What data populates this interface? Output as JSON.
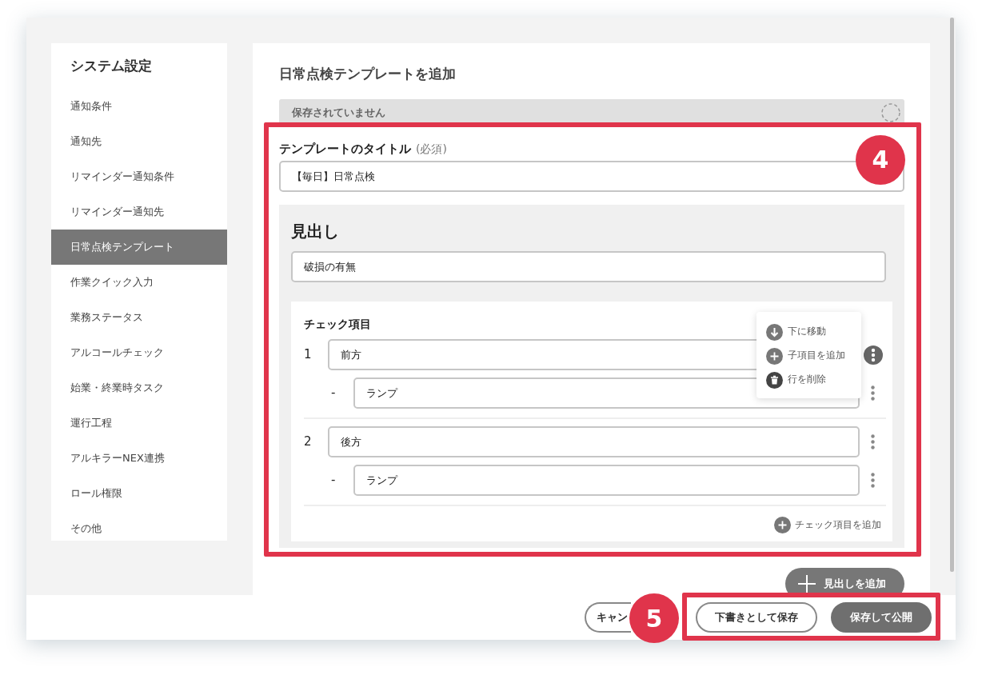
{
  "sidebar": {
    "title": "システム設定",
    "items": [
      {
        "label": "通知条件",
        "selected": false
      },
      {
        "label": "通知先",
        "selected": false
      },
      {
        "label": "リマインダー通知条件",
        "selected": false
      },
      {
        "label": "リマインダー通知先",
        "selected": false
      },
      {
        "label": "日常点検テンプレート",
        "selected": true
      },
      {
        "label": "作業クイック入力",
        "selected": false
      },
      {
        "label": "業務ステータス",
        "selected": false
      },
      {
        "label": "アルコールチェック",
        "selected": false
      },
      {
        "label": "始業・終業時タスク",
        "selected": false
      },
      {
        "label": "運行工程",
        "selected": false
      },
      {
        "label": "アルキラーNEX連携",
        "selected": false
      },
      {
        "label": "ロール権限",
        "selected": false
      },
      {
        "label": "その他",
        "selected": false
      }
    ]
  },
  "editor": {
    "title": "日常点検テンプレートを追加",
    "save_status": "保存されていません",
    "template_title": {
      "label": "テンプレートのタイトル",
      "required_mark": "(必須)",
      "value": "【毎日】日常点検"
    },
    "section": {
      "heading": "見出し",
      "value": "破損の有無",
      "checklist": {
        "title": "チェック項目",
        "items": [
          {
            "number": "1",
            "value": "前方",
            "menu_open": true,
            "children": [
              {
                "bullet": "-",
                "value": "ランプ",
                "menu_open": false
              }
            ]
          },
          {
            "number": "2",
            "value": "後方",
            "menu_open": false,
            "children": [
              {
                "bullet": "-",
                "value": "ランプ",
                "menu_open": false
              }
            ]
          }
        ],
        "menu": {
          "items": [
            {
              "kind": "move_down",
              "label": "下に移動"
            },
            {
              "kind": "add_child",
              "label": "子項目を追加"
            },
            {
              "kind": "delete",
              "label": "行を削除"
            }
          ]
        },
        "add_label": "チェック項目を追加"
      }
    },
    "add_heading_label": "見出しを追加"
  },
  "footer": {
    "buttons": [
      {
        "kind": "outline",
        "label": "キャン"
      },
      {
        "kind": "outline",
        "label": "下書きとして保存"
      },
      {
        "kind": "filled",
        "label": "保存して公開"
      }
    ]
  },
  "annotations": [
    {
      "number": "4"
    },
    {
      "number": "5"
    }
  ]
}
